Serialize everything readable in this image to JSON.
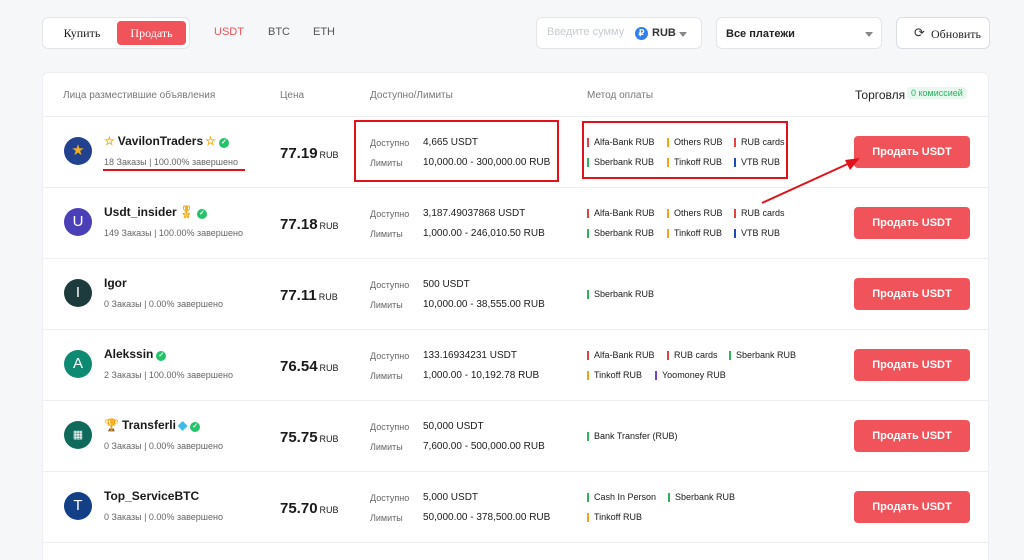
{
  "toolbar": {
    "buy_label": "Купить",
    "sell_label": "Продать",
    "currencies": [
      "USDT",
      "BTC",
      "ETH"
    ],
    "amount_placeholder": "Введите сумму",
    "fiat": "RUB",
    "fiat_icon": "₽",
    "payments_select": "Все платежи",
    "refresh_label": "Обновить"
  },
  "table": {
    "headers": {
      "advertisers": "Лица разместившие объявления",
      "price": "Цена",
      "available": "Доступно/Лимиты",
      "method": "Метод оплаты",
      "trade": "Торговля",
      "fee_badge": "0 комиссией"
    },
    "available_label": "Доступно",
    "limits_label": "Лимиты",
    "currency_suffix": "RUB",
    "button_label": "Продать USDT",
    "rows": [
      {
        "avatar": "★",
        "name": "VavilonTraders",
        "orders": "18 Заказы | 100.00% завершено",
        "price": "77.19",
        "available": "4,665 USDT",
        "limits": "10,000.00 - 300,000.00 RUB",
        "methods": [
          "Alfa-Bank RUB",
          "Others RUB",
          "RUB cards",
          "Sberbank RUB",
          "Tinkoff RUB",
          "VTB RUB"
        ]
      },
      {
        "avatar": "U",
        "name": "Usdt_insider",
        "orders": "149 Заказы | 100.00% завершено",
        "price": "77.18",
        "available": "3,187.49037868 USDT",
        "limits": "1,000.00 - 246,010.50 RUB",
        "methods": [
          "Alfa-Bank RUB",
          "Others RUB",
          "RUB cards",
          "Sberbank RUB",
          "Tinkoff RUB",
          "VTB RUB"
        ]
      },
      {
        "avatar": "I",
        "name": "Igor",
        "orders": "0 Заказы | 0.00% завершено",
        "price": "77.11",
        "available": "500 USDT",
        "limits": "10,000.00 - 38,555.00 RUB",
        "methods": [
          "Sberbank RUB"
        ]
      },
      {
        "avatar": "A",
        "name": "Alekssin",
        "orders": "2 Заказы | 100.00% завершено",
        "price": "76.54",
        "available": "133.16934231 USDT",
        "limits": "1,000.00 - 10,192.78 RUB",
        "methods": [
          "Alfa-Bank RUB",
          "RUB cards",
          "Sberbank RUB",
          "Tinkoff RUB",
          "Yoomoney RUB"
        ]
      },
      {
        "avatar": "▦",
        "name": "Transferli",
        "orders": "0 Заказы | 0.00% завершено",
        "price": "75.75",
        "available": "50,000 USDT",
        "limits": "7,600.00 - 500,000.00 RUB",
        "methods": [
          "Bank Transfer (RUB)"
        ]
      },
      {
        "avatar": "T",
        "name": "Top_ServiceBTC",
        "orders": "0 Заказы | 0.00% завершено",
        "price": "75.70",
        "available": "5,000 USDT",
        "limits": "50,000.00 - 378,500.00 RUB",
        "methods": [
          "Cash In Person",
          "Sberbank RUB",
          "Tinkoff RUB"
        ]
      }
    ]
  },
  "icons": {
    "star_pre": "☆",
    "star_post": "☆",
    "medal": "🎖",
    "trophy": "🏆",
    "diamond": "◆",
    "check": "✓",
    "refresh": "⟳"
  },
  "colors": {
    "accent": "#f0535a",
    "annotation": "#e0131c",
    "verified": "#23c36a"
  }
}
